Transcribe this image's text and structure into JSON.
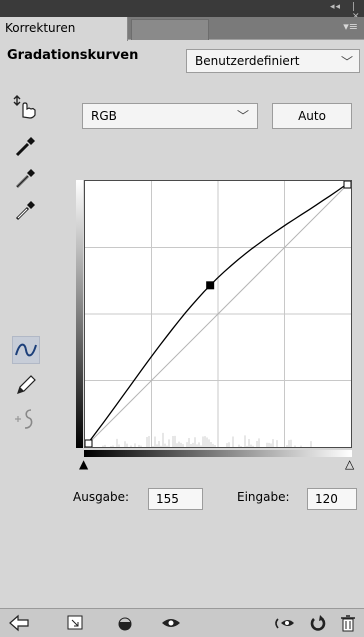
{
  "panel": {
    "tab_label": "Korrekturen",
    "title": "Gradationskurven",
    "preset_value": "Benutzerdefiniert",
    "channel_value": "RGB",
    "auto_label": "Auto"
  },
  "curve": {
    "points": [
      [
        0,
        0
      ],
      [
        120,
        155
      ],
      [
        255,
        255
      ]
    ],
    "selected_point_index": 1,
    "grid_divisions": 4,
    "histogram_present": true
  },
  "io": {
    "output_label": "Ausgabe:",
    "output_value": "155",
    "input_label": "Eingabe:",
    "input_value": "120"
  },
  "icons": {
    "top_controls": "collapse-close-icon",
    "panel_menu": "panel-menu-icon",
    "dropdown": "chevron-down-icon",
    "tools": [
      "on-image-adjust-icon",
      "eyedropper-black-icon",
      "eyedropper-gray-icon",
      "eyedropper-white-icon",
      "curve-points-icon",
      "pencil-icon",
      "smooth-curve-icon"
    ],
    "bottom": [
      "back-arrow-icon",
      "clip-to-layer-icon",
      "visibility-toggle-icon",
      "eye-icon",
      "view-previous-icon",
      "reset-icon",
      "trash-icon"
    ]
  },
  "colors": {
    "panel_bg": "#d6d6d6",
    "topbar_bg": "#3a3a3a",
    "active_tool_bg": "#c7cdd8"
  }
}
